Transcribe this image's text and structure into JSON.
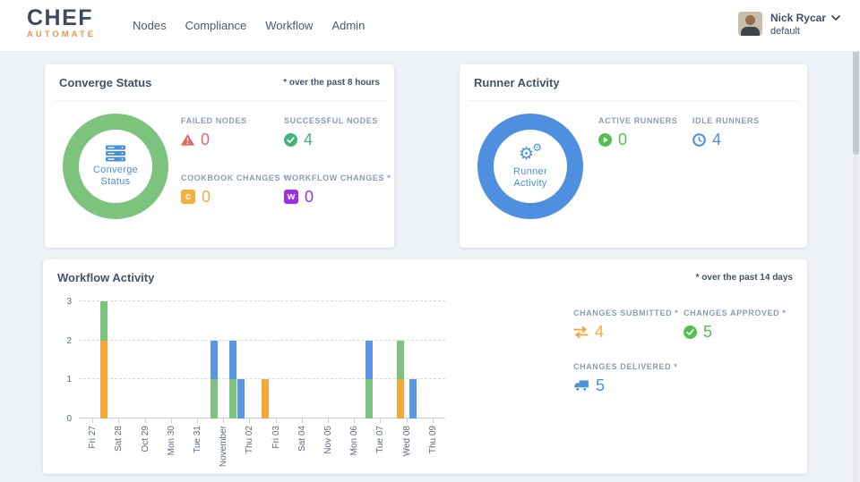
{
  "nav": {
    "logo": {
      "primary": "CHEF",
      "secondary": "AUTOMATE"
    },
    "items": [
      {
        "label": "Nodes"
      },
      {
        "label": "Compliance"
      },
      {
        "label": "Workflow"
      },
      {
        "label": "Admin"
      }
    ],
    "user": {
      "name": "Nick Rycar",
      "org": "default"
    }
  },
  "converge_card": {
    "title": "Converge Status",
    "note": "* over the past 8 hours",
    "donut": {
      "label_line1": "Converge",
      "label_line2": "Status",
      "ring_color": "#7CC47E",
      "icon": "server-icon"
    },
    "stats": [
      {
        "label": "FAILED NODES",
        "value": "0",
        "icon": "warning-triangle-icon",
        "color": "#DC6A64"
      },
      {
        "label": "SUCCESSFUL NODES",
        "value": "4",
        "icon": "check-circle-icon",
        "color": "#3FB57C"
      },
      {
        "label": "COOKBOOK CHANGES *",
        "value": "0",
        "icon": "cookbook-badge-icon",
        "color": "#F5A93B"
      },
      {
        "label": "WORKFLOW CHANGES *",
        "value": "0",
        "icon": "workflow-badge-icon",
        "color": "#9B30E8"
      }
    ]
  },
  "runner_card": {
    "title": "Runner Activity",
    "donut": {
      "label_line1": "Runner",
      "label_line2": "Activity",
      "ring_color": "#4E8FE0",
      "icon": "gears-icon"
    },
    "stats": [
      {
        "label": "ACTIVE RUNNERS",
        "value": "0",
        "icon": "play-circle-icon",
        "color": "#55BE52"
      },
      {
        "label": "IDLE RUNNERS",
        "value": "4",
        "icon": "clock-icon",
        "color": "#4A90D9"
      }
    ]
  },
  "workflow_card": {
    "title": "Workflow Activity",
    "note": "* over the past 14 days",
    "stats": [
      {
        "label": "CHANGES SUBMITTED *",
        "value": "4",
        "icon": "swap-arrows-icon",
        "color": "#F5A93B"
      },
      {
        "label": "CHANGES APPROVED *",
        "value": "5",
        "icon": "check-circle-icon",
        "color": "#55BE52"
      },
      {
        "label": "CHANGES DELIVERED *",
        "value": "5",
        "icon": "truck-icon",
        "color": "#4A90D9"
      }
    ]
  },
  "chart_data": {
    "type": "bar",
    "stacked": true,
    "title": "Workflow Activity",
    "xlabel": "",
    "ylabel": "",
    "ylim": [
      0,
      3
    ],
    "yticks": [
      0,
      1,
      2,
      3
    ],
    "grid": "dashed-horizontal",
    "categories": [
      "Fri 27",
      "Sat 28",
      "Oct 29",
      "Mon 30",
      "Tue 31",
      "November",
      "Thu 02",
      "Fri 03",
      "Sat 04",
      "Nov 05",
      "Mon 06",
      "Tue 07",
      "Wed 08",
      "Thu 09"
    ],
    "series_colors": {
      "submitted": "#F5A93B",
      "approved": "#7CC47E",
      "delivered": "#5A96E3"
    },
    "bars": [
      {
        "near_label": "Fri 27",
        "x_frac": 0.068,
        "segments": [
          {
            "series": "submitted",
            "value": 2
          },
          {
            "series": "approved",
            "value": 1
          }
        ]
      },
      {
        "near_label": "Tue 31",
        "x_frac": 0.369,
        "segments": [
          {
            "series": "approved",
            "value": 1
          },
          {
            "series": "delivered",
            "value": 1
          }
        ]
      },
      {
        "near_label": "November",
        "x_frac": 0.42,
        "segments": [
          {
            "series": "approved",
            "value": 1
          },
          {
            "series": "delivered",
            "value": 1
          }
        ]
      },
      {
        "near_label": "November",
        "x_frac": 0.443,
        "segments": [
          {
            "series": "delivered",
            "value": 1
          }
        ]
      },
      {
        "near_label": "Thu 02",
        "x_frac": 0.509,
        "segments": [
          {
            "series": "submitted",
            "value": 1
          }
        ]
      },
      {
        "near_label": "Mon 06",
        "x_frac": 0.792,
        "segments": [
          {
            "series": "approved",
            "value": 1
          },
          {
            "series": "delivered",
            "value": 1
          }
        ]
      },
      {
        "near_label": "Tue 07",
        "x_frac": 0.878,
        "segments": [
          {
            "series": "submitted",
            "value": 1
          },
          {
            "series": "approved",
            "value": 1
          }
        ]
      },
      {
        "near_label": "Wed 08",
        "x_frac": 0.912,
        "segments": [
          {
            "series": "delivered",
            "value": 1
          }
        ]
      }
    ],
    "totals": {
      "changes_submitted": 4,
      "changes_approved": 5,
      "changes_delivered": 5
    }
  }
}
